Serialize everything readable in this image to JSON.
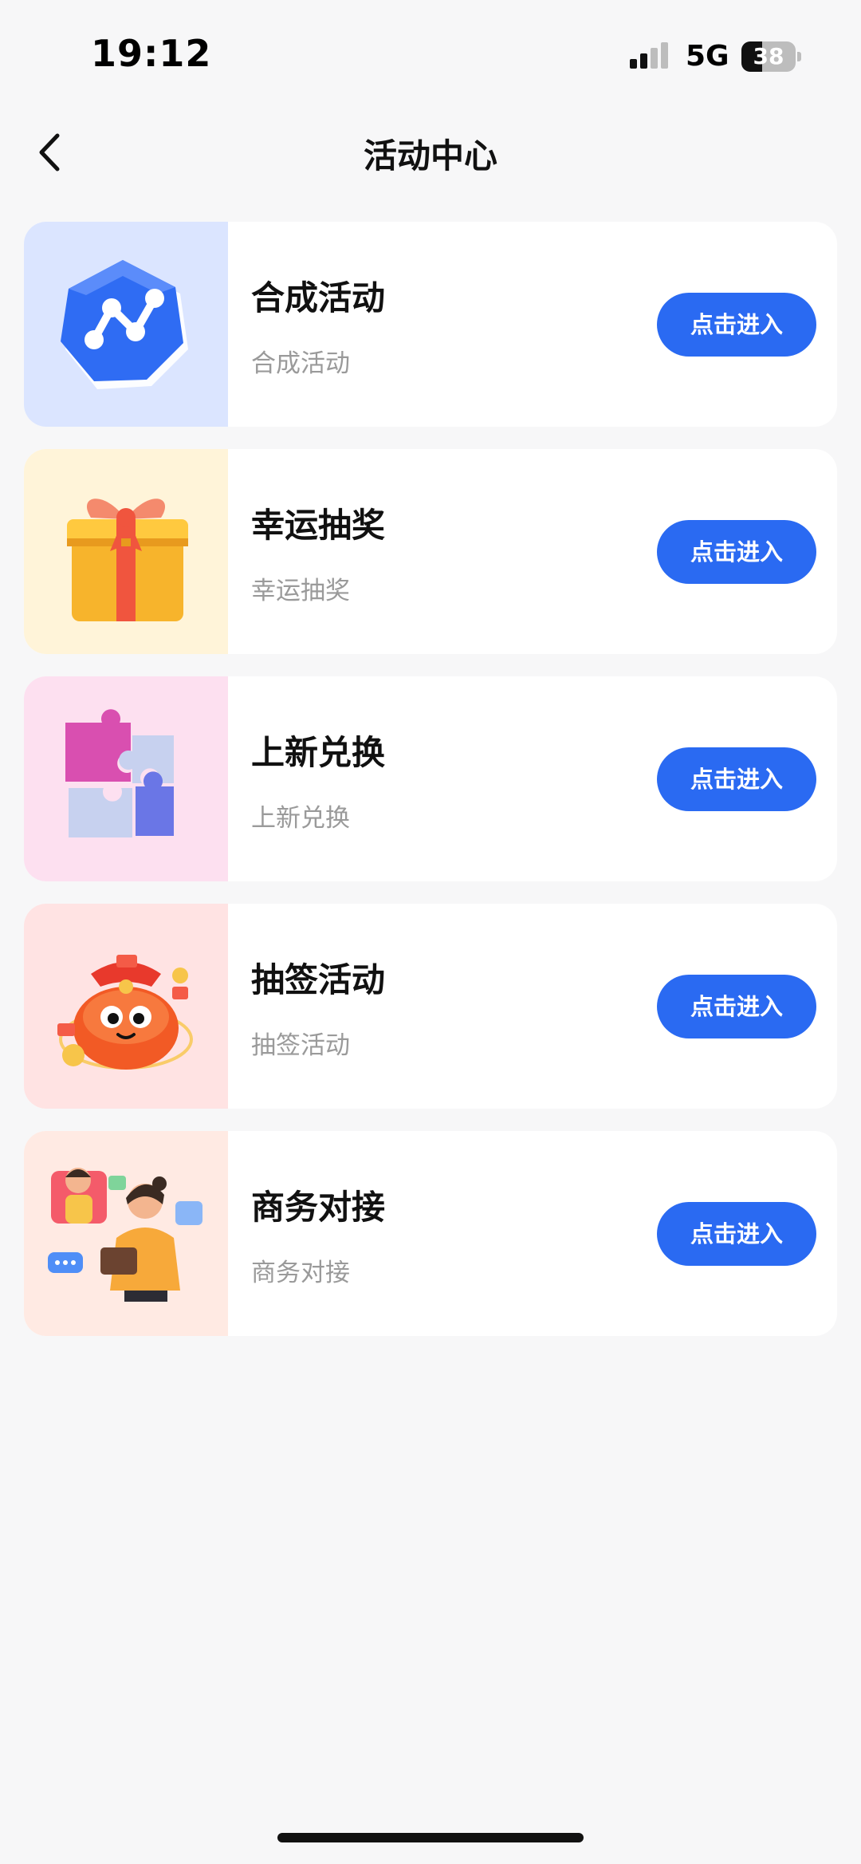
{
  "status_bar": {
    "time": "19:12",
    "network": "5G",
    "battery": "38",
    "battery_level": 0.38,
    "signal_icon": "cellular-signal-icon",
    "battery_icon": "battery-icon"
  },
  "nav": {
    "title": "活动中心",
    "back_icon": "chevron-left-icon"
  },
  "colors": {
    "accent": "#2a6af2",
    "background": "#f7f7f8",
    "card": "#ffffff",
    "subtitle": "#9a9a9a"
  },
  "activities": [
    {
      "title": "合成活动",
      "subtitle": "合成活动",
      "button_label": "点击进入",
      "icon": "synthesis-hexagon-icon",
      "thumb_bg": "#dbe5ff"
    },
    {
      "title": "幸运抽奖",
      "subtitle": "幸运抽奖",
      "button_label": "点击进入",
      "icon": "gift-box-icon",
      "thumb_bg": "#fff4d9"
    },
    {
      "title": "上新兑换",
      "subtitle": "上新兑换",
      "button_label": "点击进入",
      "icon": "puzzle-icon",
      "thumb_bg": "#fde0f0"
    },
    {
      "title": "抽签活动",
      "subtitle": "抽签活动",
      "button_label": "点击进入",
      "icon": "lucky-bag-icon",
      "thumb_bg": "#ffe3e3"
    },
    {
      "title": "商务对接",
      "subtitle": "商务对接",
      "button_label": "点击进入",
      "icon": "business-people-icon",
      "thumb_bg": "#ffeae3"
    }
  ]
}
